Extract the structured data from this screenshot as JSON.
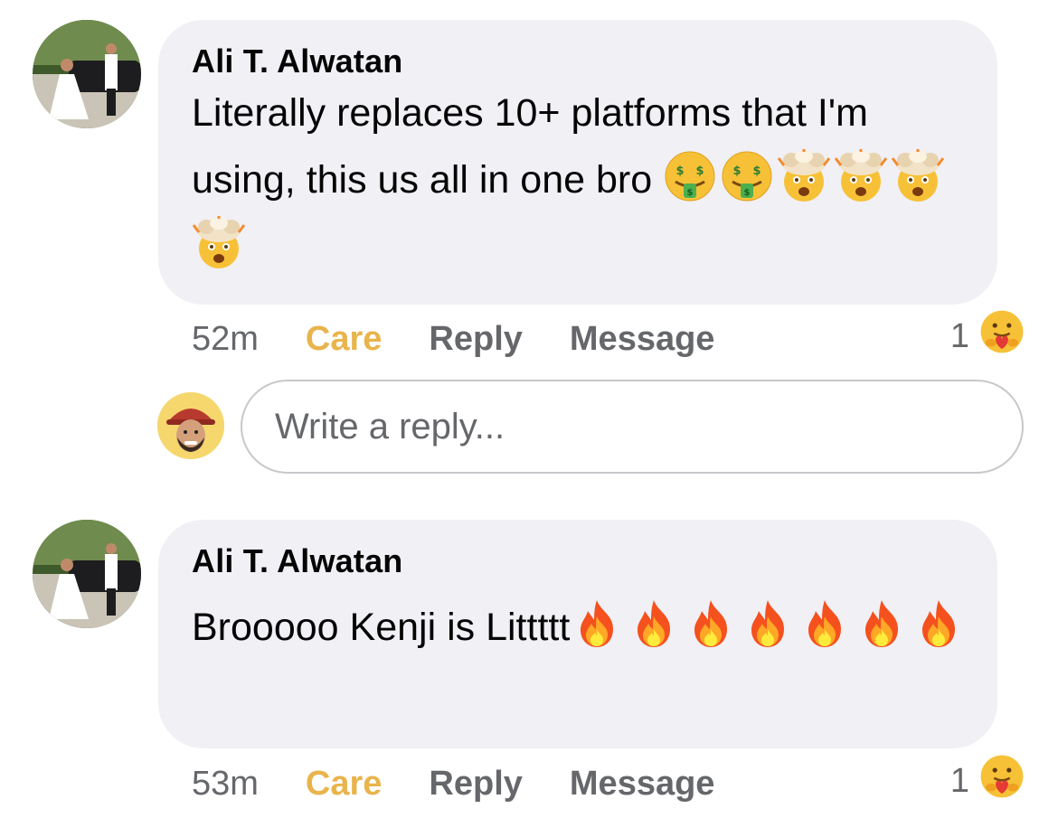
{
  "comments": [
    {
      "author": "Ali T. Alwatan",
      "text": "Literally replaces 10+ platforms that I'm using, this us all in one bro",
      "emojis": [
        "money-mouth-face",
        "money-mouth-face",
        "exploding-head",
        "exploding-head",
        "exploding-head",
        "exploding-head"
      ],
      "time": "52m",
      "actions": {
        "care": "Care",
        "reply": "Reply",
        "message": "Message"
      },
      "reaction_count": "1",
      "reaction_icon": "care-reaction-icon"
    },
    {
      "author": "Ali T. Alwatan",
      "text": "Brooooo Kenji is Littttt",
      "emojis": [
        "fire",
        "fire",
        "fire",
        "fire",
        "fire",
        "fire",
        "fire"
      ],
      "time": "53m",
      "actions": {
        "care": "Care",
        "reply": "Reply",
        "message": "Message"
      },
      "reaction_count": "1",
      "reaction_icon": "care-reaction-icon"
    }
  ],
  "reply": {
    "placeholder": "Write a reply..."
  },
  "colors": {
    "care": "#e9b44c",
    "meta": "#65676b",
    "bubble": "#f0f0f5",
    "text": "#050505"
  }
}
